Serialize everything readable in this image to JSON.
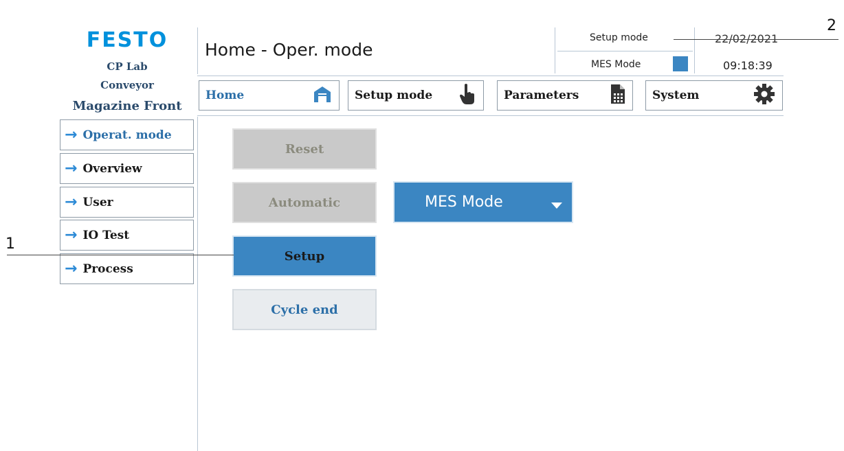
{
  "brand": {
    "logo_text": "FESTO",
    "station_line1": "CP Lab",
    "station_line2": "Conveyor",
    "station_line3": "Magazine Front"
  },
  "header": {
    "title": "Home - Oper. mode",
    "mode_label": "Setup mode",
    "mes_label": "MES Mode",
    "mes_indicator_color": "#3b86c2",
    "date": "22/02/2021",
    "time": "09:18:39"
  },
  "nav_tabs": [
    {
      "label": "Home",
      "icon": "factory-icon",
      "active": true
    },
    {
      "label": "Setup mode",
      "icon": "hand-pointer-icon",
      "active": false
    },
    {
      "label": "Parameters",
      "icon": "document-icon",
      "active": false
    },
    {
      "label": "System",
      "icon": "gear-icon",
      "active": false
    }
  ],
  "sidebar": {
    "items": [
      {
        "label": "Operat. mode",
        "active": true
      },
      {
        "label": "Overview",
        "active": false
      },
      {
        "label": "User",
        "active": false
      },
      {
        "label": "IO Test",
        "active": false
      },
      {
        "label": "Process",
        "active": false
      }
    ]
  },
  "main": {
    "buttons": [
      {
        "label": "Reset",
        "state": "disabled"
      },
      {
        "label": "Automatic",
        "state": "disabled"
      },
      {
        "label": "Setup",
        "state": "active"
      },
      {
        "label": "Cycle end",
        "state": "normal"
      }
    ],
    "mode_select": {
      "selected": "MES Mode"
    }
  },
  "callouts": {
    "one": "1",
    "two": "2"
  },
  "colors": {
    "accent": "#3b86c2",
    "brand_blue": "#0091dc",
    "disabled_bg": "#c9c9c9"
  }
}
